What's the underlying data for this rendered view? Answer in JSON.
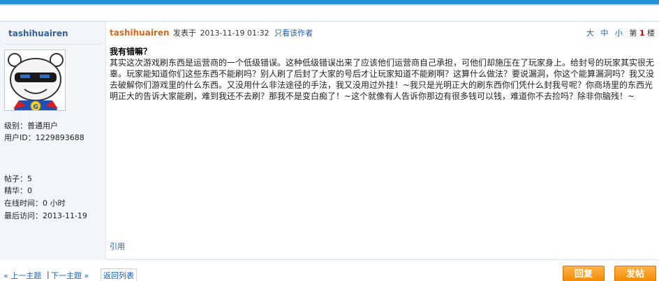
{
  "author": {
    "username": "tashihuairen",
    "level_label": "级别：",
    "level_value": "普通用户",
    "uid_label": "用户ID：",
    "uid_value": "1229893688",
    "posts_label": "帖子：",
    "posts_value": "5",
    "essence_label": "精华：",
    "essence_value": "0",
    "online_label": "在线时间：",
    "online_value": "0 小时",
    "last_visit_label": "最后访问：",
    "last_visit_value": "2013-11-19"
  },
  "post": {
    "author": "tashihuairen",
    "posted_label": "发表于",
    "time": "2013-11-19 01:32",
    "only_author": "只看该作者",
    "font_large": "大",
    "font_medium": "中",
    "font_small": "小",
    "floor_prefix": "第",
    "floor_number": "1",
    "floor_suffix": "楼",
    "title": "我有错嘛？",
    "body": "其实这次游戏刷东西是运营商的一个低级错误。这种低级错误出来了应该他们运营商自己承担，可他们却施压在了玩家身上。给封号的玩家其实很无辜。玩家能知道你们这些东西不能刷吗？别人刷了后封了大家的号后才让玩家知道不能刷啊？这算什么做法？要说漏洞，你这个能算漏洞吗？我又没去破解你们游戏里的什么东西。又没用什么非法途径的手法，我又没用过外挂！~我只是光明正大的刷东西你们凭什么封我号呢？你商场里的东西光明正大的告诉大家能刷，难到我还不去刷？那我不是变白痴了！~这个就像有人告诉你那边有很多钱可以钱，难道你不去捡吗？除非你脑残！~",
    "quote": "引用"
  },
  "nav": {
    "prev": "« 上一主题",
    "sep": "|",
    "next": "下一主题 »",
    "back": "返回列表"
  },
  "buttons": {
    "reply": "回复",
    "new_post": "发帖"
  },
  "colors": {
    "accent": "#1f8fd6",
    "author_name": "#d2691e",
    "link": "#1e5fae",
    "floor": "#cc0000",
    "button": "#f08a00"
  }
}
